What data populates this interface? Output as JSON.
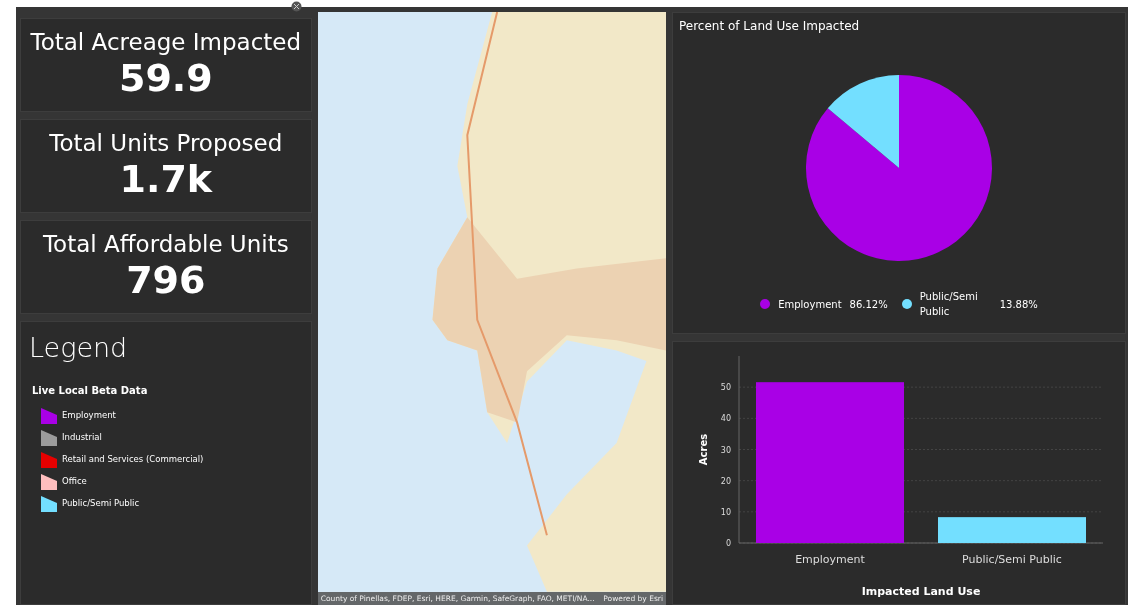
{
  "stats": [
    {
      "label": "Total Acreage Impacted",
      "value": "59.9"
    },
    {
      "label": "Total Units Proposed",
      "value": "1.7k"
    },
    {
      "label": "Total Affordable Units",
      "value": "796"
    }
  ],
  "legend": {
    "title": "Legend",
    "layer": "Live Local Beta Data",
    "items": [
      {
        "label": "Employment",
        "color": "#a900e6"
      },
      {
        "label": "Industrial",
        "color": "#9c9c9c"
      },
      {
        "label": "Retail and Services (Commercial)",
        "color": "#e60000"
      },
      {
        "label": "Office",
        "color": "#ffbebe"
      },
      {
        "label": "Public/Semi Public",
        "color": "#73dfff"
      }
    ]
  },
  "map": {
    "attribution": "County of Pinellas, FDEP, Esri, HERE, Garmin, SafeGraph, FAO, METI/NA...",
    "powered_by": "Powered by Esri"
  },
  "pie_panel": {
    "chart_data": {
      "type": "pie",
      "title": "Percent of Land Use Impacted",
      "categories": [
        "Employment",
        "Public/Semi Public"
      ],
      "values": [
        86.12,
        13.88
      ],
      "colors": [
        "#a900e6",
        "#73dfff"
      ],
      "value_labels": [
        "86.12%",
        "13.88%"
      ]
    }
  },
  "bar_panel": {
    "chart_data": {
      "type": "bar",
      "xlabel": "Impacted Land Use",
      "ylabel": "Acres",
      "categories": [
        "Employment",
        "Public/Semi Public"
      ],
      "values": [
        51.6,
        8.3
      ],
      "colors": [
        "#a900e6",
        "#73dfff"
      ],
      "ylim": [
        0,
        60
      ],
      "yticks": [
        0,
        10,
        20,
        30,
        40,
        50
      ],
      "grid": true
    }
  }
}
